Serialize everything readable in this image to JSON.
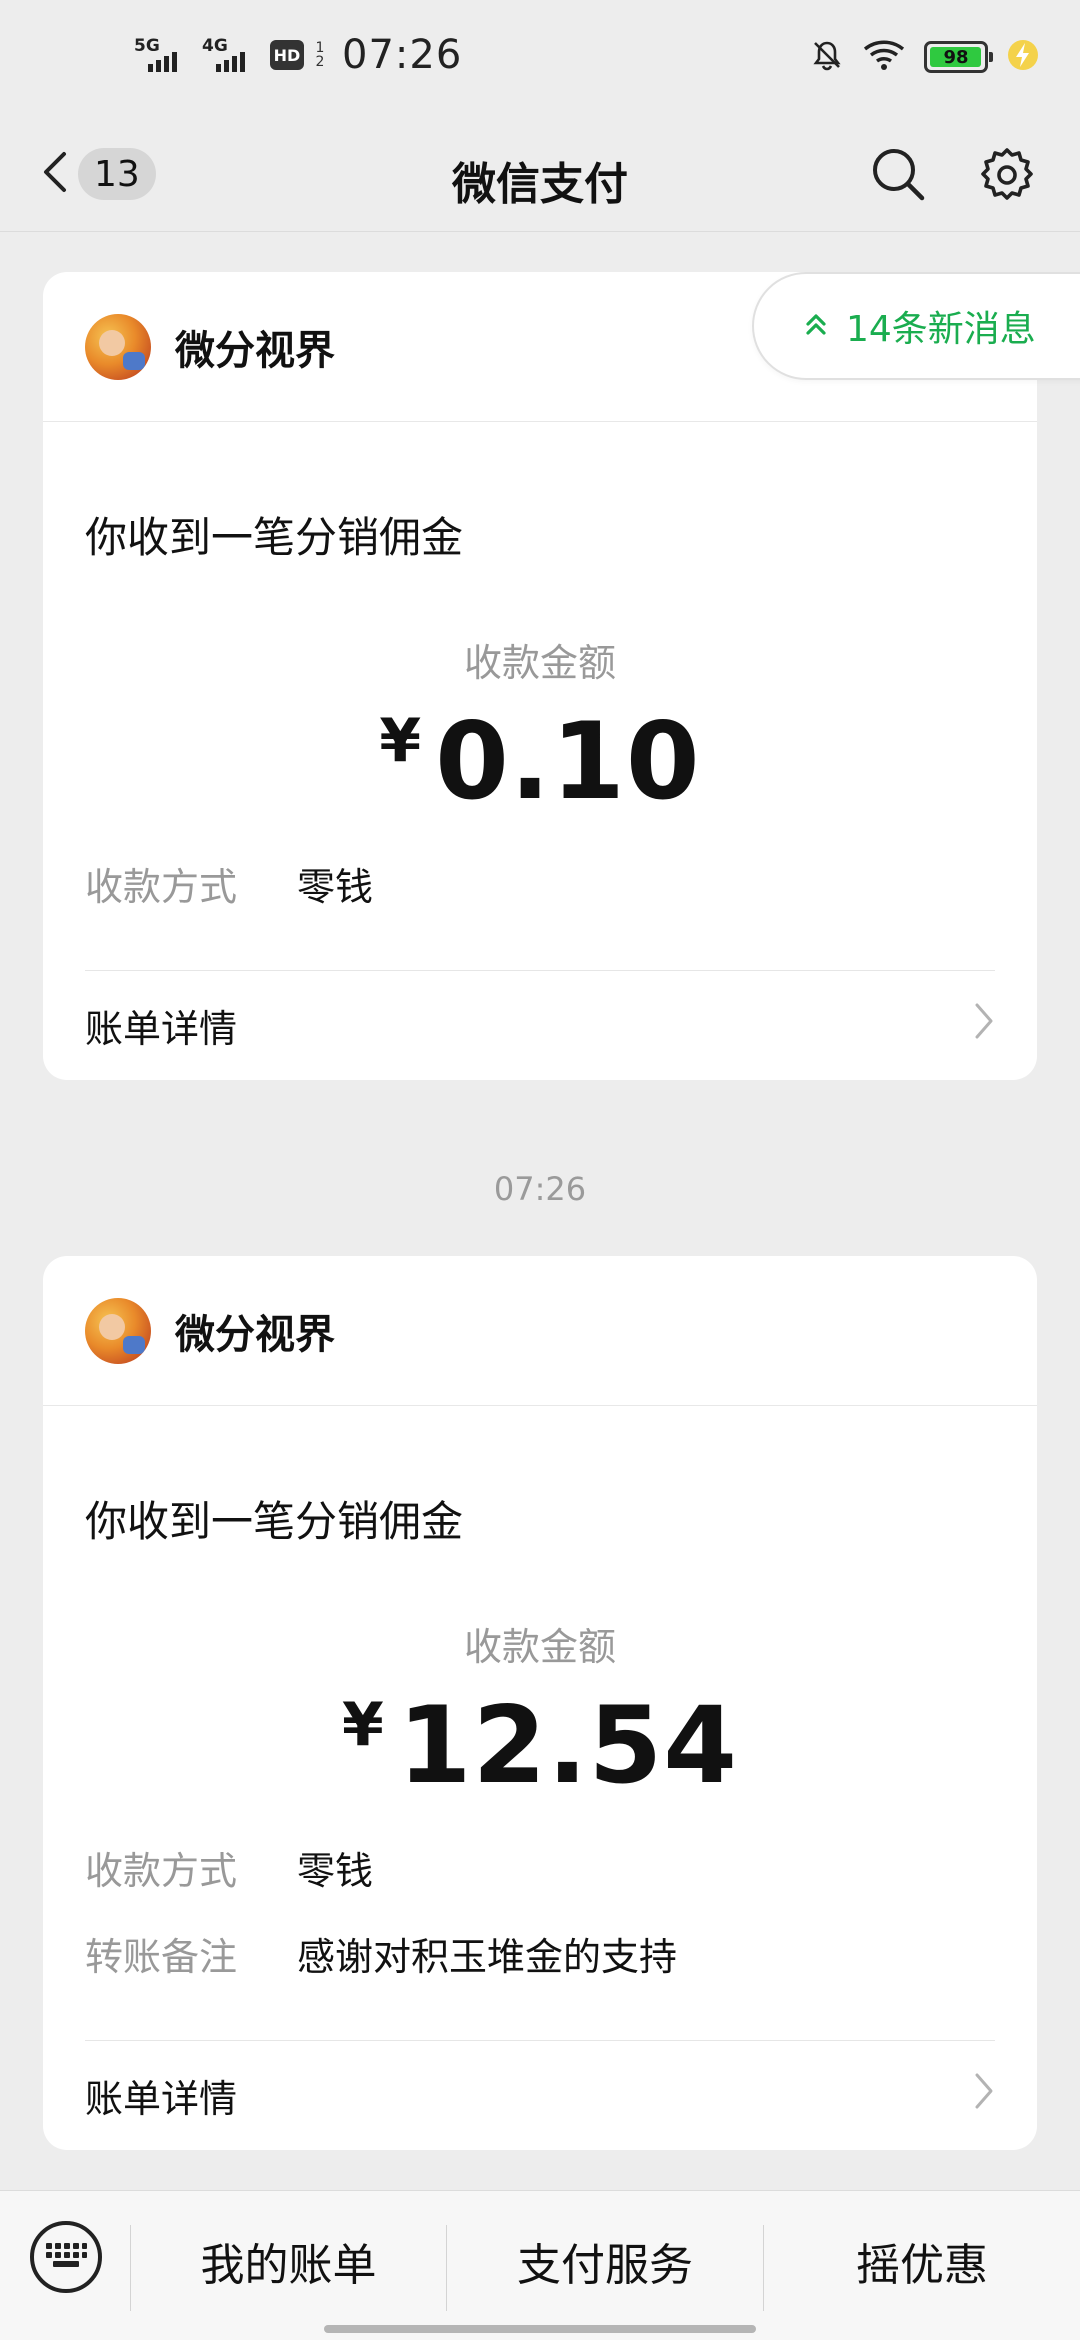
{
  "status_bar": {
    "sim1_gen": "5G",
    "sim2_gen": "4G",
    "hd_label": "HD",
    "hd_sub": "1 2",
    "time": "07:26",
    "battery_level": "98",
    "battery_fraction": 0.98,
    "battery_color": "#2fc940",
    "icons": [
      "silent-bell-icon",
      "wifi-icon",
      "battery-icon",
      "charging-icon"
    ]
  },
  "header": {
    "back_icon": "chevron-left-icon",
    "unread_count": "13",
    "title": "微信支付",
    "search_icon": "search-icon",
    "settings_icon": "gear-icon"
  },
  "new_messages": {
    "icon": "double-chevron-up-icon",
    "label": "14条新消息",
    "color": "#1aad4f"
  },
  "cards": [
    {
      "merchant": "微分视界",
      "title": "你收到一笔分销佣金",
      "amount_label": "收款金额",
      "currency": "¥",
      "amount": "0.10",
      "fields": [
        {
          "key": "收款方式",
          "value": "零钱"
        }
      ],
      "detail_link": "账单详情"
    },
    {
      "merchant": "微分视界",
      "title": "你收到一笔分销佣金",
      "amount_label": "收款金额",
      "currency": "¥",
      "amount": "12.54",
      "fields": [
        {
          "key": "收款方式",
          "value": "零钱"
        },
        {
          "key": "转账备注",
          "value": "感谢对积玉堆金的支持"
        }
      ],
      "detail_link": "账单详情"
    }
  ],
  "timestamp": "07:26",
  "bottom_menu": {
    "keyboard_icon": "keyboard-icon",
    "items": [
      "我的账单",
      "支付服务",
      "摇优惠"
    ]
  }
}
